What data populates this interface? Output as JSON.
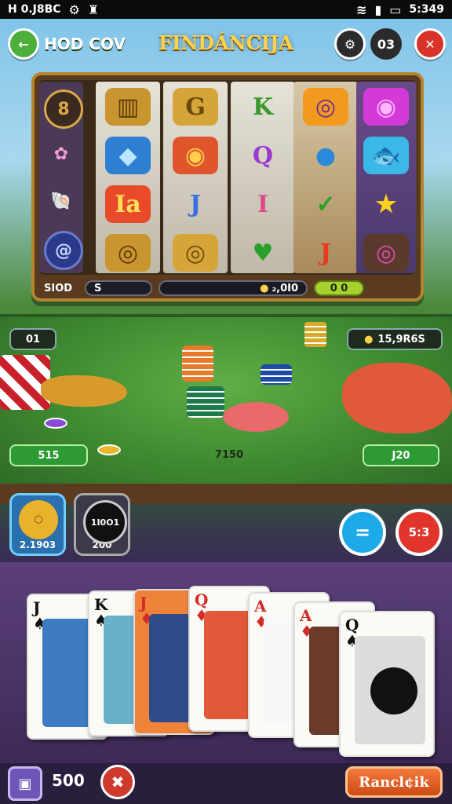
{
  "status_bar": {
    "left_text": "H 0.J8BC",
    "time": "5:349"
  },
  "header": {
    "back_icon": "arrow-left-icon",
    "left_title": "HOD COV",
    "title": "FINDÁNCIJA",
    "counter": "03"
  },
  "slot": {
    "side_icons": [
      "8",
      "✿",
      "🐚",
      "@"
    ],
    "reels": [
      [
        "▥",
        "◆",
        "Ia",
        "◎"
      ],
      [
        "G",
        "◉",
        "J",
        "◎"
      ],
      [
        "K",
        "Q",
        "I",
        "♥"
      ],
      [
        "◎",
        "●",
        "✓",
        "J"
      ],
      [
        "◉",
        "🐟",
        "★",
        "◎"
      ]
    ],
    "bar_label": "SIOD",
    "bar_value": "S",
    "bar_coins": "₂,0I0",
    "bar_green": "0 0"
  },
  "table": {
    "top_left_tag": "01",
    "top_right_tag": "15,9R6S",
    "left_amount": "515",
    "center_amount": "7150",
    "right_amount": "J20"
  },
  "powerups": [
    {
      "value": "2.1903"
    },
    {
      "title": "1I0O1",
      "value": "200"
    }
  ],
  "buttons": {
    "menu_icon": "=",
    "red_label": "5:3"
  },
  "cards": [
    {
      "rank": "J",
      "suit": "♠",
      "color": "#111111",
      "art": "#3f7bc2"
    },
    {
      "rank": "K",
      "suit": "♠",
      "color": "#111111",
      "art": "#6bb0c9"
    },
    {
      "rank": "J",
      "suit": "♦",
      "color": "#d32a2a",
      "art": "#2f4c8a"
    },
    {
      "rank": "Q",
      "suit": "♦",
      "color": "#d32a2a",
      "art": "#e8e0d0"
    },
    {
      "rank": "A",
      "suit": "♦",
      "color": "#d32a2a",
      "art": "#f8f8f8"
    },
    {
      "rank": "A",
      "suit": "♦",
      "color": "#d32a2a",
      "art": "#6a3a2a"
    },
    {
      "rank": "Q",
      "suit": "♠",
      "color": "#111111",
      "art": "#dcdcdc"
    }
  ],
  "footer": {
    "balance": "500",
    "action_label": "Rancl¢ik"
  }
}
